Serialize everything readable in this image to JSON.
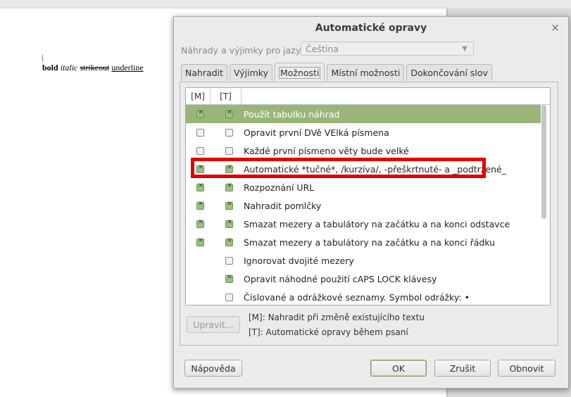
{
  "document": {
    "bold": "bold",
    "italic": "italic",
    "strikeout": "strikeout",
    "underline": "underline"
  },
  "dialog": {
    "title": "Automatické opravy",
    "close_symbol": "×",
    "language_label": "Náhrady a výjimky pro jazyk:",
    "language_value": "Čeština"
  },
  "tabs": [
    "Nahradit",
    "Výjimky",
    "Možnosti",
    "Místní možnosti",
    "Dokončování slov"
  ],
  "active_tab": "Možnosti",
  "columns": {
    "m": "[M]",
    "t": "[T]"
  },
  "options": [
    {
      "label": "Použít tabulku náhrad",
      "m": true,
      "t": true,
      "selected": true
    },
    {
      "label": "Opravit první DVě VElká písmena",
      "m": false,
      "t": false
    },
    {
      "label": "Každé první písmeno věty bude velké",
      "m": false,
      "t": false
    },
    {
      "label": "Automatické *tučné*, /kurzíva/, -přeškrtnuté- a _podtržené_",
      "m": true,
      "t": true
    },
    {
      "label": "Rozpoznání URL",
      "m": true,
      "t": true
    },
    {
      "label": "Nahradit pomlčky",
      "m": true,
      "t": true
    },
    {
      "label": "Smazat mezery a tabulátory na začátku a na konci odstavce",
      "m": true,
      "t": true
    },
    {
      "label": "Smazat mezery a tabulátory na začátku a na konci řádku",
      "m": true,
      "t": true
    },
    {
      "label": "Ignorovat dvojité mezery",
      "m": null,
      "t": false
    },
    {
      "label": "Opravit náhodné použití cAPS LOCK klávesy",
      "m": null,
      "t": true
    },
    {
      "label": "Číslované a odrážkové seznamy. Symbol odrážky: •",
      "m": null,
      "t": false
    }
  ],
  "buttons": {
    "edit": "Upravit...",
    "help": "Nápověda",
    "ok": "OK",
    "cancel": "Zrušit",
    "reset": "Obnovit"
  },
  "legend": {
    "m": "[M]: Nahradit při změně existujícího textu",
    "t": "[T]: Automatické opravy během psaní"
  },
  "colors": {
    "selected_row": "#99b57a",
    "highlight": "#e00000"
  }
}
